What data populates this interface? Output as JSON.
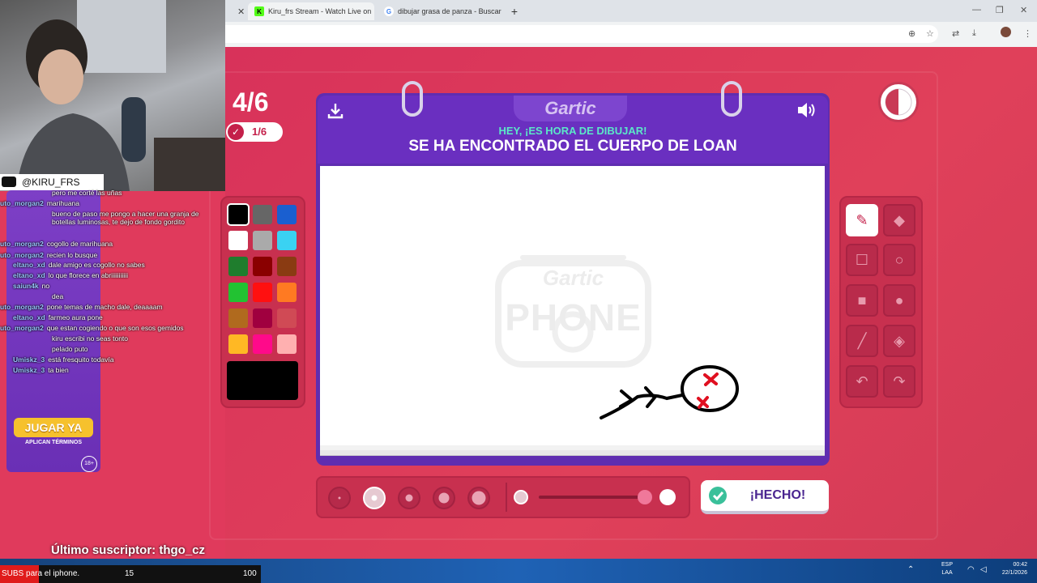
{
  "browser": {
    "tabs": [
      {
        "title": "Kiru_frs Stream - Watch Live on",
        "icon": "kick-logo-icon"
      },
      {
        "title": "dibujar grasa de panza - Buscar",
        "icon": "google-logo-icon"
      }
    ],
    "new_tab_label": "+"
  },
  "game": {
    "round": "4/6",
    "guessed_count": "1/6",
    "logo": "Gartic",
    "watermark_line1": "Gartic",
    "watermark_line2": "PHONE",
    "prompt_heading": "HEY, ¡ES HORA DE DIBUJAR!",
    "prompt_text": "SE HA ENCONTRADO EL CUERPO DE LOAN",
    "done_label": "¡HECHO!",
    "palette": [
      "#000000",
      "#666666",
      "#1a5fd0",
      "#ffffff",
      "#aaaaaa",
      "#3ad2f2",
      "#1f7d2d",
      "#8a0000",
      "#8a3b12",
      "#22c232",
      "#ff1010",
      "#ff7a22",
      "#b06a1e",
      "#a0003f",
      "#d04a55",
      "#ffb824",
      "#ff0a8a",
      "#ffb0b0"
    ],
    "selected_color": "#000000",
    "tools": [
      "pencil-icon",
      "eraser-icon",
      "rectangle-outline-icon",
      "circle-outline-icon",
      "rectangle-filled-icon",
      "circle-filled-icon",
      "line-icon",
      "fill-bucket-icon",
      "undo-icon",
      "redo-icon"
    ],
    "active_tool": "pencil-icon",
    "brush_sizes": 5,
    "selected_brush_size": 2
  },
  "stream": {
    "handle": "@KIRU_FRS",
    "ad_cta": "JUGAR YA",
    "ad_terms": "APLICAN TÉRMINOS",
    "age_badge": "18+",
    "last_sub": "Último suscriptor: thgo_cz",
    "chat": [
      {
        "user": "",
        "text": "pero me corté las uñas"
      },
      {
        "user": "uto_morgan2",
        "text": "marihuana"
      },
      {
        "user": "",
        "text": "bueno de paso me pongo a hacer una granja de"
      },
      {
        "user": "",
        "text": "botellas luminosas, te dejo de fondo gordito"
      },
      {
        "user": "uto_morgan2",
        "text": "cogollo de marihuana"
      },
      {
        "user": "uto_morgan2",
        "text": "recien lo busque"
      },
      {
        "user": "eltano_xd",
        "text": "dale amigo es cogollo no sabes"
      },
      {
        "user": "eltano_xd",
        "text": "lo que florece en abriiiiiiiiiii"
      },
      {
        "user": "saiun4k",
        "text": "no"
      },
      {
        "user": "",
        "text": "dea"
      },
      {
        "user": "uto_morgan2",
        "text": "pone temas de macho dale, deaaaam"
      },
      {
        "user": "eltano_xd",
        "text": "farmeo aura pone"
      },
      {
        "user": "uto_morgan2",
        "text": "que estan cogiendo o que son esos gemidos"
      },
      {
        "user": "",
        "text": "kiru escribi no seas tonto"
      },
      {
        "user": "",
        "text": "pelado puto"
      },
      {
        "user": "Umiskz_3",
        "text": "está fresquito todavía"
      },
      {
        "user": "Umiskz_3",
        "text": "ta bien"
      }
    ]
  },
  "ticker": {
    "text": "SUBS para el iphone.",
    "count": "15",
    "goal": "100"
  },
  "taskbar": {
    "lang_line1": "ESP",
    "lang_line2": "LAA",
    "time": "00:42",
    "date": "22/1/2026"
  }
}
